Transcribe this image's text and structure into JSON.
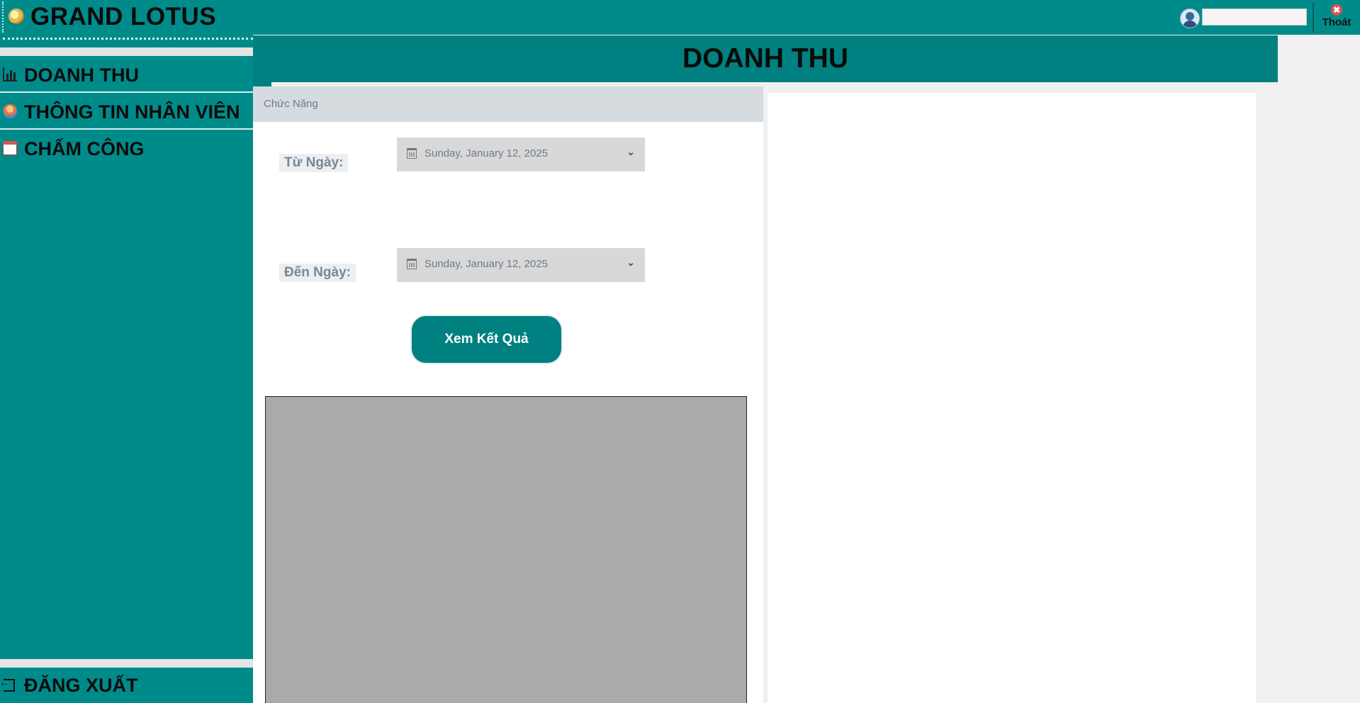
{
  "app": {
    "title": "GRAND LOTUS",
    "accent_color": "#008b8b",
    "logo_icon": "lotus-logo-icon"
  },
  "topbar": {
    "user_icon": "user-avatar-icon",
    "user_name": "",
    "exit_icon": "close-icon",
    "exit_label": "Thoát"
  },
  "sidebar": {
    "items": [
      {
        "label": "DOANH THU",
        "icon": "bar-chart-icon"
      },
      {
        "label": "THÔNG TIN NHÂN VIÊN",
        "icon": "people-icon"
      },
      {
        "label": "CHẤM CÔNG",
        "icon": "calendar-icon"
      }
    ],
    "logout": {
      "label": "ĐĂNG XUẤT",
      "icon": "logout-icon"
    }
  },
  "header": {
    "title": "DOANH THU"
  },
  "form": {
    "group_title": "Chức Năng",
    "from_label": "Từ Ngày:",
    "from_value": "Sunday, January 12, 2025",
    "to_label": "Đến Ngày:",
    "to_value": "Sunday, January 12, 2025",
    "submit_label": "Xem Kết Quả"
  }
}
